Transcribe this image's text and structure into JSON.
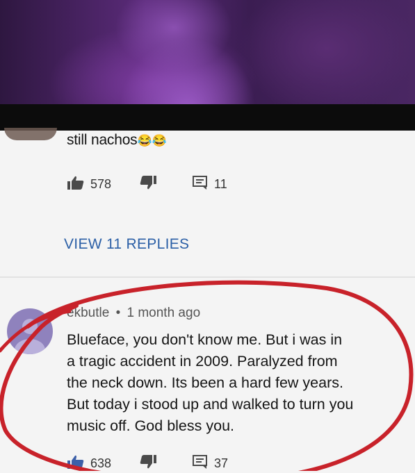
{
  "comments": [
    {
      "text": "still nachos",
      "emoji": "😂😂",
      "likes": "578",
      "replies_count": "11"
    },
    {
      "author": "ekbutle",
      "separator": "•",
      "time": "1 month ago",
      "lines": [
        "Blueface, you don't know me. But i was in",
        "a tragic accident in 2009. Paralyzed from",
        "the neck down. Its been a hard few years.",
        "But today i stood up and walked to turn you",
        "music off. God bless you."
      ],
      "likes": "638",
      "replies_count": "37"
    }
  ],
  "view_replies_label": "VIEW 11 REPLIES",
  "colors": {
    "link": "#2b5fa6",
    "highlight_circle": "#c8222a",
    "avatar": "#8f82bd",
    "video_tint": "#5b2b7a"
  },
  "icons": [
    "thumbs-up-icon",
    "thumbs-down-icon",
    "reply-icon"
  ]
}
